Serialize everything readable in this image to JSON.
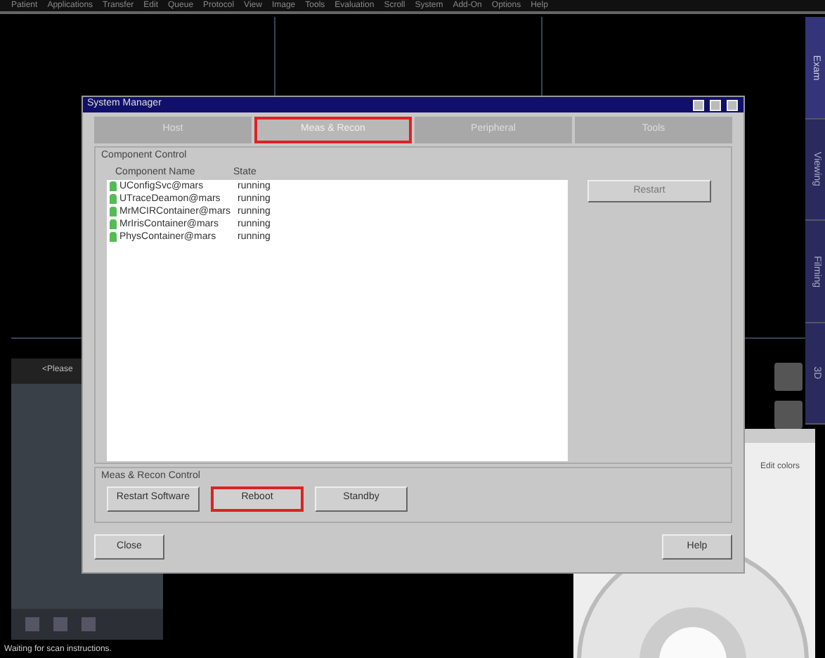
{
  "menu_bar": [
    "Patient",
    "Applications",
    "Transfer",
    "Edit",
    "Queue",
    "Protocol",
    "View",
    "Image",
    "Tools",
    "Evaluation",
    "Scroll",
    "System",
    "Add-On",
    "Options",
    "Help"
  ],
  "side_tabs": [
    {
      "label": "Exam",
      "selected": true
    },
    {
      "label": "Viewing",
      "selected": false
    },
    {
      "label": "Filming",
      "selected": false
    },
    {
      "label": "3D",
      "selected": false
    }
  ],
  "left_panel": {
    "title": "<Please",
    "status": "Waiting for scan instructions."
  },
  "dialog": {
    "title": "System Manager",
    "tabs": [
      {
        "label": "Host",
        "selected": false,
        "highlighted": false
      },
      {
        "label": "Meas & Recon",
        "selected": true,
        "highlighted": true
      },
      {
        "label": "Peripheral",
        "selected": false,
        "highlighted": false
      },
      {
        "label": "Tools",
        "selected": false,
        "highlighted": false
      }
    ],
    "component_group": "Component Control",
    "columns": [
      "Component Name",
      "State"
    ],
    "rows": [
      {
        "name": "UConfigSvc@mars",
        "state": "running"
      },
      {
        "name": "UTraceDeamon@mars",
        "state": "running"
      },
      {
        "name": "MrMCIRContainer@mars",
        "state": "running"
      },
      {
        "name": "MrIrisContainer@mars",
        "state": "running"
      },
      {
        "name": "PhysContainer@mars",
        "state": "running"
      }
    ],
    "side_button": {
      "label": "Restart",
      "disabled": true
    },
    "control_group": "Meas & Recon Control",
    "control_buttons": [
      {
        "label": "Restart Software",
        "highlighted": false
      },
      {
        "label": "Reboot",
        "highlighted": true
      },
      {
        "label": "Standby",
        "highlighted": false
      }
    ],
    "footer_buttons": [
      "Close",
      "Help"
    ]
  },
  "palette_window": {
    "edit_label": "Edit colors"
  }
}
